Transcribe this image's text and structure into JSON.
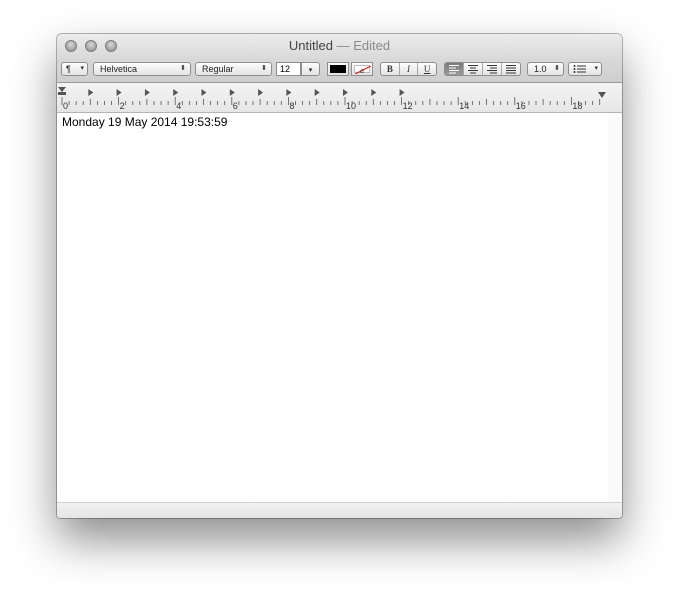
{
  "window": {
    "title": "Untitled",
    "title_suffix": "— Edited"
  },
  "toolbar": {
    "paragraph_style": "¶",
    "font_family": "Helvetica",
    "font_typeface": "Regular",
    "font_size": "12",
    "text_color": "#000000",
    "bold_label": "B",
    "italic_label": "I",
    "underline_label": "U",
    "line_spacing": "1.0",
    "list_icon": "list-bullets-icon"
  },
  "ruler": {
    "marks": [
      "0",
      "2",
      "4",
      "6",
      "8",
      "10",
      "12",
      "14",
      "16",
      "18"
    ]
  },
  "document": {
    "text": "Monday 19 May 2014 19:53:59"
  }
}
